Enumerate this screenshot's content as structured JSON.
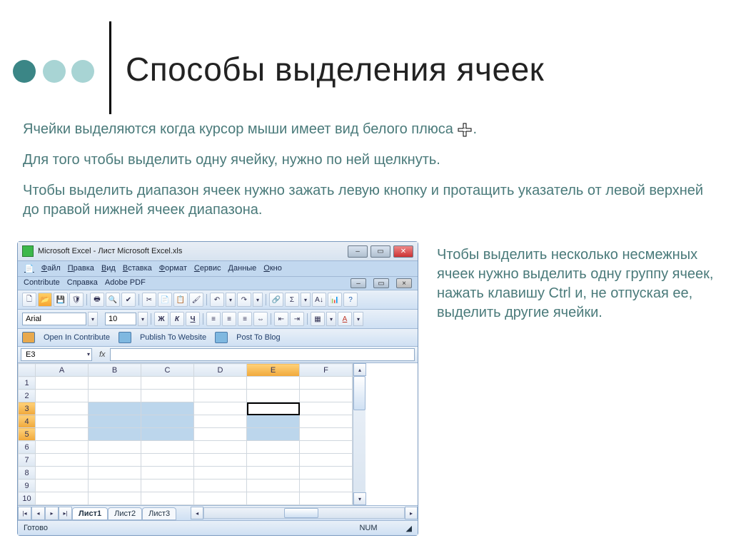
{
  "header": {
    "title": "Способы выделения ячеек"
  },
  "body": {
    "p1_a": "Ячейки выделяются когда курсор мыши имеет вид белого плюса ",
    "p1_b": ".",
    "p2": "Для того чтобы выделить одну ячейку, нужно по ней щелкнуть.",
    "p3": "Чтобы выделить диапазон ячеек нужно зажать левую кнопку и протащить указатель от левой верхней до правой нижней ячеек диапазона.",
    "right": "Чтобы выделить несколько несмежных ячеек нужно выделить одну группу ячеек, нажать клавишу Ctrl и, не отпуская ее, выделить другие ячейки."
  },
  "excel": {
    "window_title": "Microsoft Excel - Лист Microsoft Excel.xls",
    "menu": [
      "Файл",
      "Правка",
      "Вид",
      "Вставка",
      "Формат",
      "Сервис",
      "Данные",
      "Окно"
    ],
    "menu2": [
      "Contribute",
      "Справка",
      "Adobe PDF"
    ],
    "font_name": "Arial",
    "font_size": "10",
    "fmt1": "Ж",
    "fmt2": "К",
    "fmt3": "Ч",
    "sigma": "Σ",
    "percent": "%",
    "pub": {
      "open": "Open In Contribute",
      "publish": "Publish To Website",
      "post": "Post To Blog"
    },
    "namebox": "E3",
    "fx": "fx",
    "cols": [
      "A",
      "B",
      "C",
      "D",
      "E",
      "F"
    ],
    "rows": [
      "1",
      "2",
      "3",
      "4",
      "5",
      "6",
      "7",
      "8",
      "9",
      "10"
    ],
    "sheets": [
      "Лист1",
      "Лист2",
      "Лист3"
    ],
    "status_left": "Готово",
    "status_num": "NUM"
  }
}
